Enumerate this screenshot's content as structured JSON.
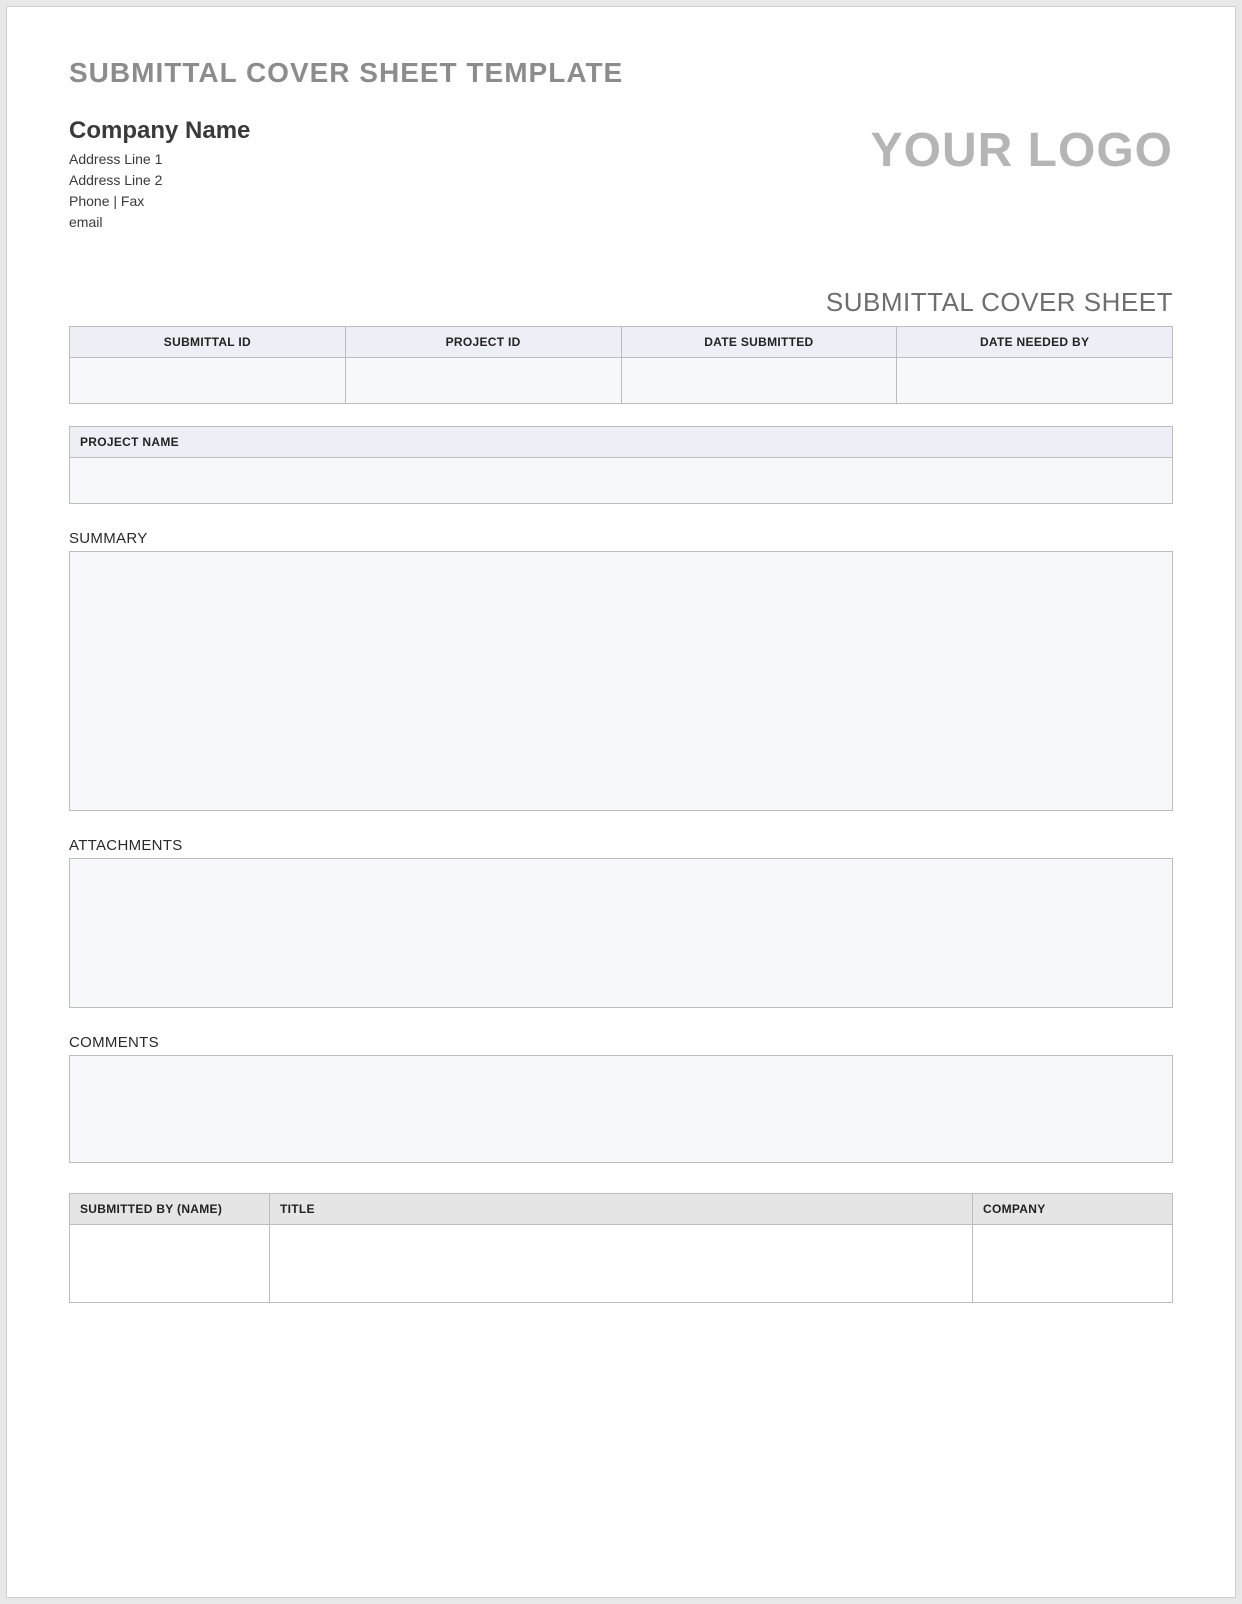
{
  "doc_title": "SUBMITTAL COVER SHEET TEMPLATE",
  "company": {
    "name": "Company Name",
    "address1": "Address Line 1",
    "address2": "Address Line 2",
    "phone_fax": "Phone  |  Fax",
    "email": "email"
  },
  "logo_text": "YOUR LOGO",
  "section_title": "SUBMITTAL COVER SHEET",
  "info_headers": {
    "submittal_id": "SUBMITTAL ID",
    "project_id": "PROJECT ID",
    "date_submitted": "DATE SUBMITTED",
    "date_needed": "DATE NEEDED BY"
  },
  "info_values": {
    "submittal_id": "",
    "project_id": "",
    "date_submitted": "",
    "date_needed": ""
  },
  "project_name_header": "PROJECT NAME",
  "project_name_value": "",
  "labels": {
    "summary": "SUMMARY",
    "attachments": "ATTACHMENTS",
    "comments": "COMMENTS"
  },
  "summary_value": "",
  "attachments_value": "",
  "comments_value": "",
  "submit_headers": {
    "name": "SUBMITTED BY (NAME)",
    "title": "TITLE",
    "company": "COMPANY"
  },
  "submit_values": {
    "name": "",
    "title": "",
    "company": ""
  }
}
